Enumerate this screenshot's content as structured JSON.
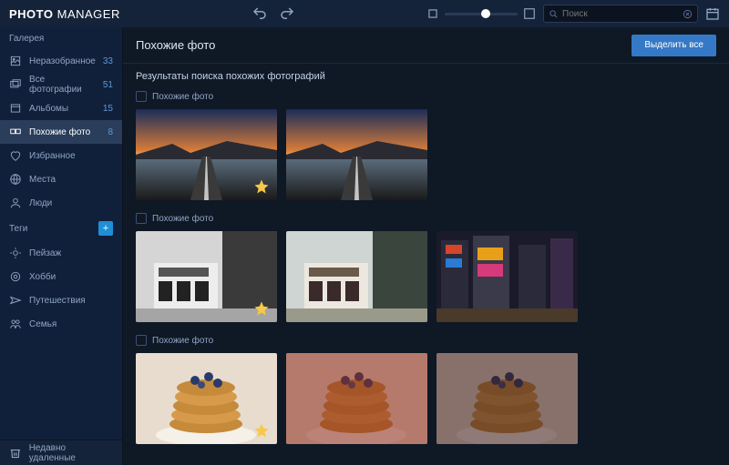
{
  "app": {
    "name_bold": "PHOTO",
    "name_rest": "MANAGER"
  },
  "search": {
    "placeholder": "Поиск"
  },
  "sidebar": {
    "gallery_header": "Галерея",
    "items": [
      {
        "icon": "unsorted",
        "label": "Неразобранное",
        "count": "33"
      },
      {
        "icon": "all",
        "label": "Все фотографии",
        "count": "51"
      },
      {
        "icon": "albums",
        "label": "Альбомы",
        "count": "15"
      },
      {
        "icon": "similar",
        "label": "Похожие фото",
        "count": "8"
      },
      {
        "icon": "favorite",
        "label": "Избранное",
        "count": ""
      },
      {
        "icon": "places",
        "label": "Места",
        "count": ""
      },
      {
        "icon": "people",
        "label": "Люди",
        "count": ""
      }
    ],
    "active_index": 3,
    "tags_header": "Теги",
    "tags": [
      {
        "icon": "landscape",
        "label": "Пейзаж"
      },
      {
        "icon": "hobby",
        "label": "Хобби"
      },
      {
        "icon": "travel",
        "label": "Путешествия"
      },
      {
        "icon": "family",
        "label": "Семья"
      }
    ],
    "trash_label": "Недавно удаленные"
  },
  "main": {
    "title": "Похожие фото",
    "select_all": "Выделить все",
    "results_label": "Результаты поиска похожих фотографий",
    "groups": [
      {
        "label": "Похожие фото",
        "thumbs": [
          "road-sunset-star",
          "road-sunset"
        ]
      },
      {
        "label": "Похожие фото",
        "thumbs": [
          "street-bw-star",
          "street-color",
          "times-sq"
        ]
      },
      {
        "label": "Похожие фото",
        "thumbs": [
          "pancakes-star",
          "pancakes-red",
          "pancakes-dark"
        ]
      }
    ]
  }
}
